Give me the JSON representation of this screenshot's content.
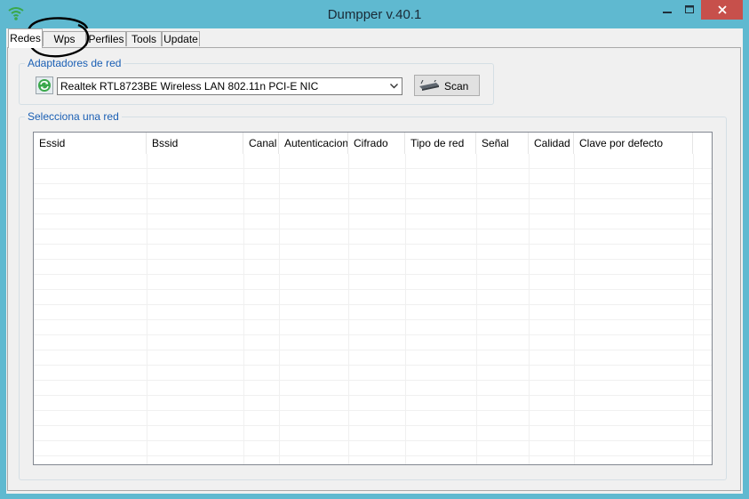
{
  "window": {
    "title": "Dumpper v.40.1",
    "minimize_glyph": "—",
    "maximize_glyph": "☐",
    "close_glyph": "✕"
  },
  "tabs": [
    {
      "label": "Redes",
      "active": true
    },
    {
      "label": "Wps",
      "active": false
    },
    {
      "label": "Perfiles",
      "active": false
    },
    {
      "label": "Tools",
      "active": false
    },
    {
      "label": "Update",
      "active": false
    }
  ],
  "adapters": {
    "group_label": "Adaptadores de red",
    "selected": "Realtek RTL8723BE Wireless LAN 802.11n PCI-E NIC",
    "scan_label": "Scan"
  },
  "networks": {
    "group_label": "Selecciona una red",
    "columns": [
      "Essid",
      "Bssid",
      "Canal",
      "Autenticacion",
      "Cifrado",
      "Tipo de red",
      "Señal",
      "Calidad",
      "Clave por defecto"
    ],
    "rows": []
  },
  "colors": {
    "titlebar": "#5fb9d0",
    "close_button": "#c7504b",
    "group_label": "#1a5fb4",
    "annotation": "#000000"
  },
  "icons": {
    "app": "wifi-signal-icon",
    "refresh": "refresh-icon",
    "scan": "router-icon",
    "dropdown": "chevron-down-icon"
  }
}
